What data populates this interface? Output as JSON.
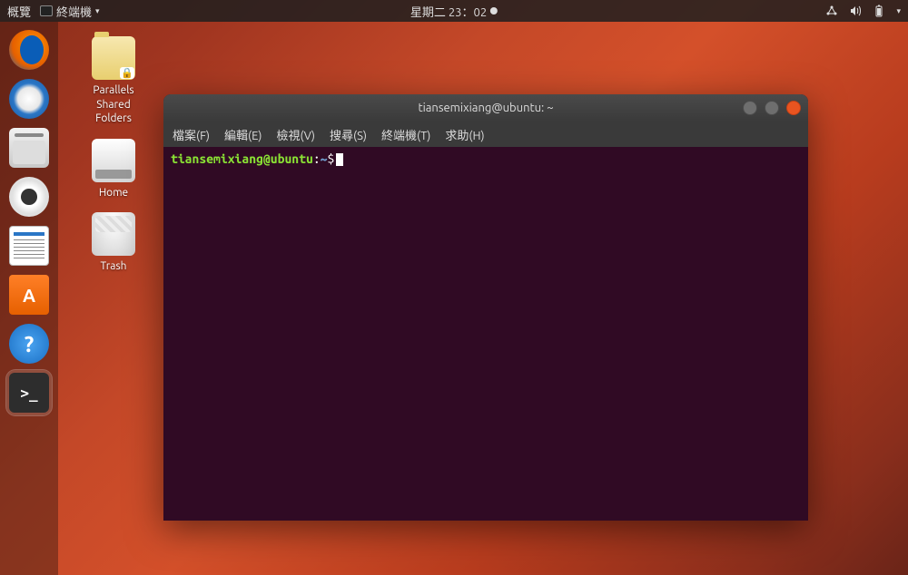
{
  "top_panel": {
    "activities": "概覽",
    "app_name": "終端機",
    "clock": "星期二 23：02"
  },
  "desktop": {
    "icons": [
      {
        "label": "Parallels\nShared\nFolders"
      },
      {
        "label": "Home"
      },
      {
        "label": "Trash"
      }
    ]
  },
  "terminal": {
    "title": "tiansemixiang@ubuntu: ~",
    "menu": {
      "file": "檔案(F)",
      "edit": "編輯(E)",
      "view": "檢視(V)",
      "search": "搜尋(S)",
      "terminal": "終端機(T)",
      "help": "求助(H)"
    },
    "prompt": {
      "user_host": "tiansemixiang@ubuntu",
      "separator": ":",
      "path": "~",
      "symbol": "$"
    }
  }
}
